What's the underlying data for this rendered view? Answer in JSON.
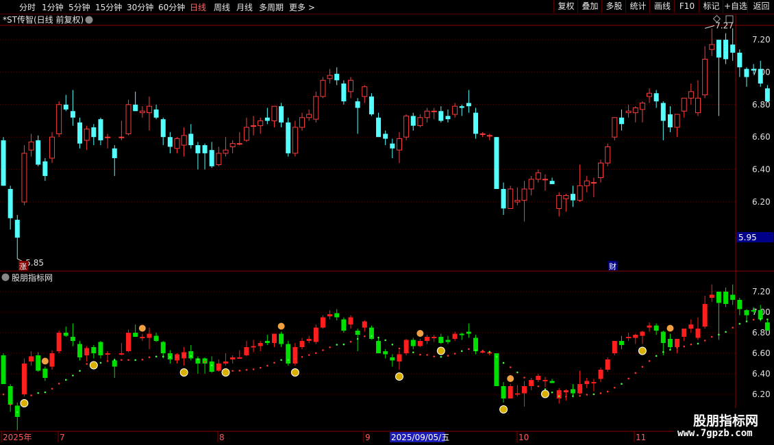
{
  "toolbar": {
    "periods": [
      "分时",
      "1分钟",
      "5分钟",
      "15分钟",
      "30分钟",
      "60分钟",
      "日线",
      "周线",
      "月线",
      "多周期",
      "更多 >"
    ],
    "active_period": "日线",
    "right_buttons": [
      "复权",
      "叠加",
      "多股",
      "统计",
      "画线",
      "F10",
      "标记",
      "+自选",
      "返回"
    ]
  },
  "main_chart": {
    "title": "*ST传智(日线 前复权)",
    "price_high_label": "7.27",
    "price_low_label": "5.85",
    "current_price_tag": "5.95",
    "badge_zhang": "涨",
    "badge_cai": "财",
    "y_ticks": [
      "7.20",
      "7.00",
      "6.80",
      "6.60",
      "6.40",
      "6.20"
    ]
  },
  "indicator": {
    "title": "股朋指标网",
    "y_ticks": [
      "7.20",
      "7.00",
      "6.80",
      "6.60",
      "6.40",
      "6.20"
    ]
  },
  "time_axis": {
    "labels": [
      "2025年",
      "7",
      "8",
      "9",
      "10",
      "11"
    ],
    "cursor_date": "2025/09/05/五"
  },
  "watermark": {
    "name": "股朋指标网",
    "url": "www.7gpzb.com"
  },
  "colors": {
    "up": "#ff3c3c",
    "down": "#54ffff",
    "ind_up": "#ff1e1e",
    "ind_down": "#00e000",
    "grid": "#5a0000",
    "border": "#8b0000",
    "axis_text": "#ff5a5a",
    "tag_bg": "#000088",
    "cursor_bg": "#1a1ab4"
  },
  "chart_data": {
    "type": "candlestick",
    "series": [
      {
        "values": [
          [
            6.58,
            6.6,
            6.3,
            6.3
          ],
          [
            6.28,
            6.3,
            6.03,
            6.1
          ],
          [
            6.09,
            6.12,
            5.85,
            5.98
          ],
          [
            6.2,
            6.55,
            6.18,
            6.5
          ],
          [
            6.52,
            6.62,
            6.48,
            6.57
          ],
          [
            6.58,
            6.61,
            6.42,
            6.43
          ],
          [
            6.45,
            6.47,
            6.33,
            6.36
          ],
          [
            6.47,
            6.63,
            6.44,
            6.6
          ],
          [
            6.62,
            6.82,
            6.6,
            6.8
          ],
          [
            6.8,
            6.86,
            6.76,
            6.77
          ],
          [
            6.76,
            6.89,
            6.67,
            6.72
          ],
          [
            6.69,
            6.72,
            6.53,
            6.56
          ],
          [
            6.58,
            6.67,
            6.52,
            6.65
          ],
          [
            6.66,
            6.68,
            6.55,
            6.6
          ],
          [
            6.71,
            6.72,
            6.55,
            6.58
          ],
          [
            6.6,
            6.62,
            6.53,
            6.6
          ],
          [
            6.53,
            6.55,
            6.36,
            6.47
          ],
          [
            6.6,
            6.7,
            6.58,
            6.6
          ],
          [
            6.62,
            6.83,
            6.61,
            6.8
          ],
          [
            6.8,
            6.88,
            6.76,
            6.76
          ],
          [
            6.75,
            6.79,
            6.72,
            6.76
          ],
          [
            6.75,
            6.85,
            6.64,
            6.79
          ],
          [
            6.77,
            6.8,
            6.71,
            6.72
          ],
          [
            6.71,
            6.72,
            6.55,
            6.6
          ],
          [
            6.6,
            6.63,
            6.5,
            6.54
          ],
          [
            6.53,
            6.6,
            6.5,
            6.59
          ],
          [
            6.55,
            6.66,
            6.48,
            6.61
          ],
          [
            6.62,
            6.68,
            6.53,
            6.55
          ],
          [
            6.55,
            6.57,
            6.4,
            6.5
          ],
          [
            6.55,
            6.56,
            6.4,
            6.5
          ],
          [
            6.52,
            6.57,
            6.41,
            6.42
          ],
          [
            6.43,
            6.54,
            6.42,
            6.5
          ],
          [
            6.5,
            6.6,
            6.48,
            6.52
          ],
          [
            6.54,
            6.58,
            6.5,
            6.56
          ],
          [
            6.56,
            6.63,
            6.55,
            6.56
          ],
          [
            6.58,
            6.72,
            6.57,
            6.66
          ],
          [
            6.67,
            6.73,
            6.61,
            6.67
          ],
          [
            6.67,
            6.72,
            6.62,
            6.7
          ],
          [
            6.72,
            6.78,
            6.68,
            6.7
          ],
          [
            6.7,
            6.76,
            6.66,
            6.79
          ],
          [
            6.79,
            6.81,
            6.66,
            6.69
          ],
          [
            6.69,
            6.72,
            6.48,
            6.5
          ],
          [
            6.5,
            6.7,
            6.48,
            6.66
          ],
          [
            6.66,
            6.75,
            6.64,
            6.72
          ],
          [
            6.72,
            6.77,
            6.7,
            6.74
          ],
          [
            6.71,
            6.88,
            6.69,
            6.85
          ],
          [
            6.85,
            6.97,
            6.84,
            6.95
          ],
          [
            6.96,
            7.02,
            6.93,
            6.98
          ],
          [
            6.99,
            7.03,
            6.92,
            6.95
          ],
          [
            6.93,
            6.95,
            6.8,
            6.82
          ],
          [
            6.88,
            6.97,
            6.84,
            6.95
          ],
          [
            6.82,
            6.84,
            6.62,
            6.78
          ],
          [
            6.85,
            6.92,
            6.81,
            6.91
          ],
          [
            6.85,
            6.87,
            6.73,
            6.74
          ],
          [
            6.72,
            6.75,
            6.62,
            6.6
          ],
          [
            6.62,
            6.64,
            6.55,
            6.59
          ],
          [
            6.56,
            6.59,
            6.47,
            6.53
          ],
          [
            6.52,
            6.63,
            6.44,
            6.59
          ],
          [
            6.6,
            6.74,
            6.58,
            6.73
          ],
          [
            6.73,
            6.75,
            6.64,
            6.67
          ],
          [
            6.67,
            6.74,
            6.66,
            6.72
          ],
          [
            6.72,
            6.78,
            6.69,
            6.76
          ],
          [
            6.76,
            6.78,
            6.71,
            6.76
          ],
          [
            6.76,
            6.79,
            6.69,
            6.7
          ],
          [
            6.73,
            6.77,
            6.69,
            6.71
          ],
          [
            6.74,
            6.81,
            6.72,
            6.79
          ],
          [
            6.79,
            6.8,
            6.73,
            6.78
          ],
          [
            6.81,
            6.89,
            6.75,
            6.79
          ],
          [
            6.75,
            6.78,
            6.59,
            6.62
          ],
          [
            6.62,
            6.63,
            6.6,
            6.62
          ],
          [
            6.61,
            6.62,
            6.58,
            6.61
          ],
          [
            6.6,
            6.6,
            6.3,
            6.28
          ],
          [
            6.28,
            6.32,
            6.12,
            6.16
          ],
          [
            6.16,
            6.3,
            6.18,
            6.28
          ],
          [
            6.2,
            6.29,
            6.18,
            6.21
          ],
          [
            6.21,
            6.33,
            6.08,
            6.28
          ],
          [
            6.28,
            6.36,
            6.24,
            6.34
          ],
          [
            6.34,
            6.4,
            6.32,
            6.38
          ],
          [
            6.34,
            6.37,
            6.27,
            6.34
          ],
          [
            6.33,
            6.35,
            6.31,
            6.31
          ],
          [
            6.16,
            6.26,
            6.11,
            6.24
          ],
          [
            6.22,
            6.25,
            6.14,
            6.24
          ],
          [
            6.25,
            6.3,
            6.17,
            6.21
          ],
          [
            6.21,
            6.43,
            6.2,
            6.3
          ],
          [
            6.3,
            6.36,
            6.26,
            6.33
          ],
          [
            6.32,
            6.35,
            6.23,
            6.32
          ],
          [
            6.35,
            6.46,
            6.32,
            6.44
          ],
          [
            6.44,
            6.56,
            6.42,
            6.54
          ],
          [
            6.6,
            6.71,
            6.58,
            6.72
          ],
          [
            6.72,
            6.77,
            6.64,
            6.68
          ],
          [
            6.75,
            6.8,
            6.72,
            6.76
          ],
          [
            6.75,
            6.79,
            6.69,
            6.78
          ],
          [
            6.77,
            6.82,
            6.69,
            6.81
          ],
          [
            6.85,
            6.9,
            6.81,
            6.87
          ],
          [
            6.87,
            6.89,
            6.78,
            6.82
          ],
          [
            6.81,
            6.82,
            6.58,
            6.7
          ],
          [
            6.74,
            6.79,
            6.63,
            6.66
          ],
          [
            6.66,
            6.74,
            6.6,
            6.74
          ],
          [
            6.76,
            6.84,
            6.72,
            6.84
          ],
          [
            6.84,
            6.93,
            6.8,
            6.88
          ],
          [
            6.75,
            6.95,
            6.73,
            6.84
          ],
          [
            6.86,
            7.16,
            6.84,
            7.08
          ],
          [
            7.14,
            7.27,
            7.1,
            7.17
          ],
          [
            7.2,
            7.2,
            6.73,
            7.09
          ],
          [
            7.2,
            7.24,
            7.05,
            7.08
          ],
          [
            7.17,
            7.27,
            7.07,
            7.12
          ],
          [
            7.12,
            7.14,
            6.97,
            7.03
          ],
          [
            7.02,
            7.03,
            6.91,
            6.97
          ],
          [
            7.02,
            7.05,
            6.99,
            7.01
          ],
          [
            7.02,
            7.07,
            6.91,
            6.93
          ],
          [
            6.9,
            6.92,
            6.82,
            6.82
          ]
        ]
      }
    ],
    "ylim": [
      5.8,
      7.4
    ]
  }
}
